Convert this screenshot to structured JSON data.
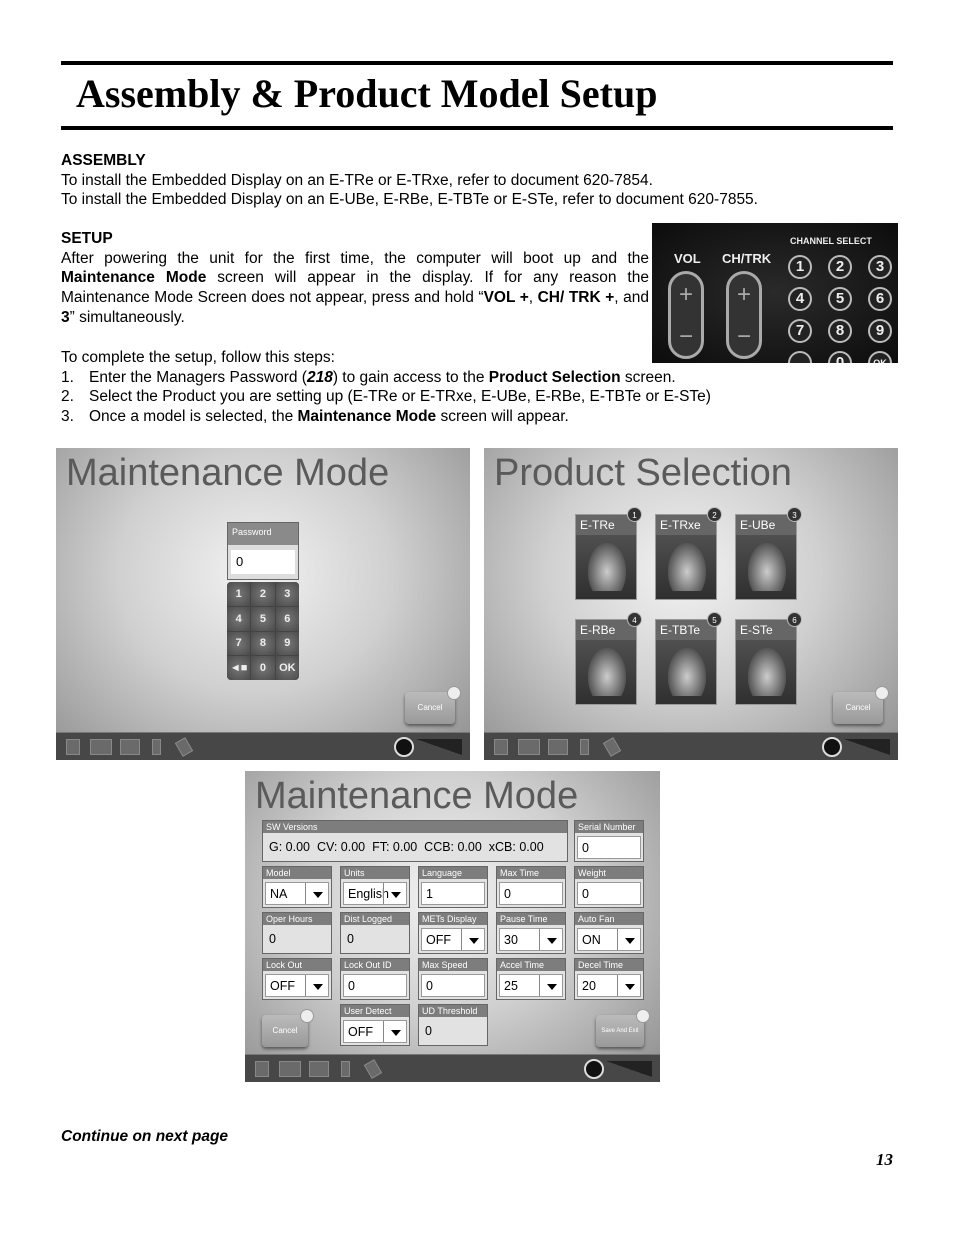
{
  "page": {
    "title": "Assembly & Product Model Setup",
    "page_number": "13",
    "footer_note": "Continue on next page"
  },
  "assembly": {
    "heading": "ASSEMBLY",
    "lines": [
      "To install the Embedded Display on an E-TRe or E-TRxe, refer to document 620-7854.",
      "To install the Embedded Display on an E-UBe, E-RBe, E-TBTe or E-STe, refer to document 620-7855."
    ]
  },
  "setup": {
    "heading": "SETUP",
    "p1": [
      "After powering the unit for the first time, the computer will boot up and the ",
      "Maintenance Mode",
      " screen will appear in the display. If for any reason the Maintenance Mode Screen does not appear, press and hold “",
      "VOL +",
      ", ",
      "CH/ TRK +",
      ", and ",
      "3",
      "” simultaneously."
    ],
    "intro": "To complete the setup, follow this steps:",
    "steps": [
      {
        "n": "1.",
        "parts": [
          "Enter the Managers Password (",
          "218",
          ") to gain access to the ",
          "Product Selection",
          " screen."
        ]
      },
      {
        "n": "2.",
        "parts": [
          "Select the Product you are setting up (E-TRe or E-TRxe, E-UBe, E-RBe, E-TBTe or E-STe)"
        ]
      },
      {
        "n": "3.",
        "parts": [
          "Once a model is selected, the ",
          "Maintenance Mode",
          " screen will appear."
        ]
      }
    ]
  },
  "console_photo": {
    "vol": "VOL",
    "chtrk": "CH/TRK",
    "channel_select": "CHANNEL SELECT",
    "keys": [
      "1",
      "2",
      "3",
      "4",
      "5",
      "6",
      "7",
      "8",
      "9",
      "",
      "0",
      "OK"
    ]
  },
  "screen1": {
    "title": "Maintenance Mode",
    "password_label": "Password",
    "password_value": "0",
    "keys": [
      "1",
      "2",
      "3",
      "4",
      "5",
      "6",
      "7",
      "8",
      "9",
      "◄■",
      "0",
      "OK"
    ],
    "cancel": "Cancel"
  },
  "screen2": {
    "title": "Product Selection",
    "products": [
      {
        "label": "E-TRe",
        "num": "1"
      },
      {
        "label": "E-TRxe",
        "num": "2"
      },
      {
        "label": "E-UBe",
        "num": "3"
      },
      {
        "label": "E-RBe",
        "num": "4"
      },
      {
        "label": "E-TBTe",
        "num": "5"
      },
      {
        "label": "E-STe",
        "num": "6"
      }
    ],
    "cancel": "Cancel"
  },
  "screen3": {
    "title": "Maintenance Mode",
    "sw_label": "SW Versions",
    "sw_value": "G: 0.00  CV: 0.00  FT: 0.00  CCB: 0.00  xCB: 0.00",
    "serial_label": "Serial Number",
    "serial_value": "0",
    "fields": [
      {
        "label": "Model",
        "value": "NA",
        "type": "select"
      },
      {
        "label": "Units",
        "value": "English",
        "type": "select"
      },
      {
        "label": "Language",
        "value": "1",
        "type": "input"
      },
      {
        "label": "Max Time",
        "value": "0",
        "type": "input"
      },
      {
        "label": "Weight",
        "value": "0",
        "type": "input"
      },
      {
        "label": "Oper Hours",
        "value": "0",
        "type": "readonly"
      },
      {
        "label": "Dist Logged",
        "value": "0",
        "type": "readonly"
      },
      {
        "label": "METs Display",
        "value": "OFF",
        "type": "select"
      },
      {
        "label": "Pause Time",
        "value": "30",
        "type": "select"
      },
      {
        "label": "Auto Fan",
        "value": "ON",
        "type": "select"
      },
      {
        "label": "Lock Out",
        "value": "OFF",
        "type": "select"
      },
      {
        "label": "Lock Out ID",
        "value": "0",
        "type": "input"
      },
      {
        "label": "Max Speed",
        "value": "0",
        "type": "input"
      },
      {
        "label": "Accel Time",
        "value": "25",
        "type": "select"
      },
      {
        "label": "Decel Time",
        "value": "20",
        "type": "select"
      },
      {
        "label": "User Detect",
        "value": "OFF",
        "type": "select"
      },
      {
        "label": "UD Threshold",
        "value": "0",
        "type": "readonly"
      }
    ],
    "cancel": "Cancel",
    "save": "Save And Exit"
  }
}
